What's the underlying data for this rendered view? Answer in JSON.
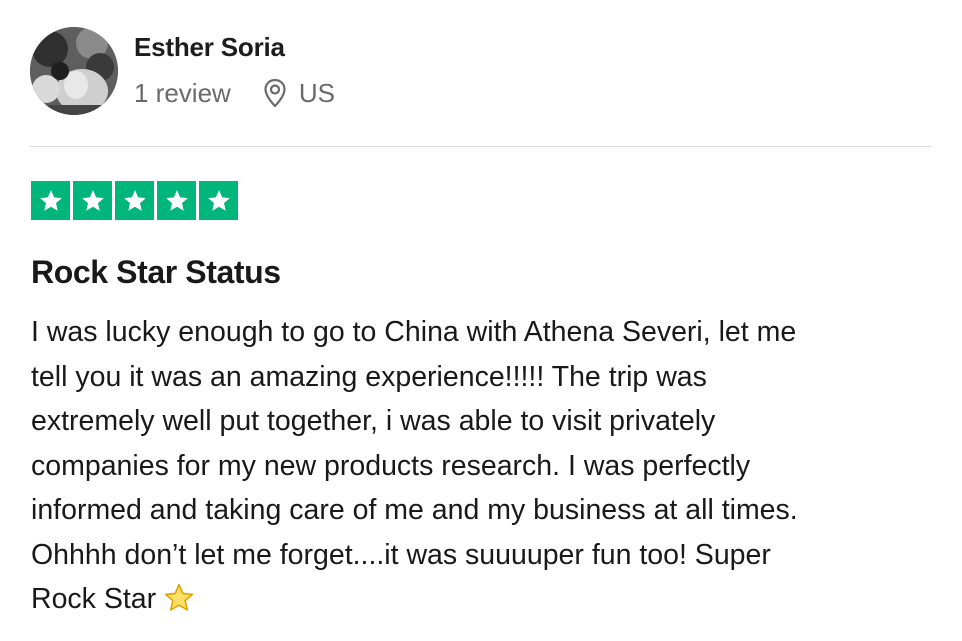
{
  "reviewer": {
    "name": "Esther Soria",
    "review_count": "1 review",
    "location": "US"
  },
  "rating": {
    "stars": 5,
    "max_stars": 5,
    "color": "#00b67a"
  },
  "review": {
    "title": "Rock Star Status",
    "body_lines": [
      "I was lucky enough to go to China with Athena Severi, let me",
      "tell you it was an amazing experience!!!!! The trip was",
      "extremely well put together, i was able to visit privately",
      "companies for my new products research. I was perfectly",
      "informed and taking care of me and my business at all times.",
      "Ohhhh don’t let me forget....it was suuuuper fun too! Super",
      "Rock Star"
    ],
    "trailing_emoji": "star-emoji"
  },
  "icons": {
    "location": "location-pin-icon",
    "rating_star": "star-icon"
  }
}
